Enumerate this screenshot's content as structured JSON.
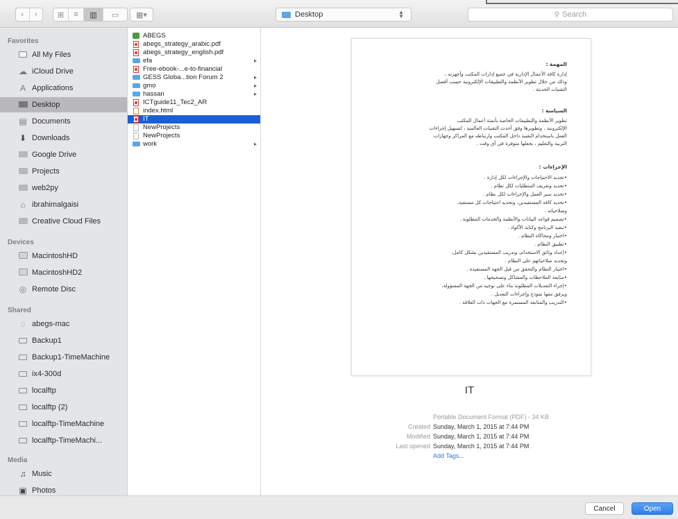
{
  "toolbar": {
    "path": "Desktop",
    "search_placeholder": "Search"
  },
  "sidebar": {
    "favorites_header": "Favorites",
    "favorites": [
      {
        "label": "All My Files",
        "icon": "all-files-icon"
      },
      {
        "label": "iCloud Drive",
        "icon": "cloud-icon"
      },
      {
        "label": "Applications",
        "icon": "applications-icon"
      },
      {
        "label": "Desktop",
        "icon": "desktop-folder-icon",
        "selected": true
      },
      {
        "label": "Documents",
        "icon": "documents-icon"
      },
      {
        "label": "Downloads",
        "icon": "downloads-icon"
      },
      {
        "label": "Google Drive",
        "icon": "folder-icon"
      },
      {
        "label": "Projects",
        "icon": "folder-icon"
      },
      {
        "label": "web2py",
        "icon": "folder-icon"
      },
      {
        "label": "ibrahimalgaisi",
        "icon": "home-icon"
      },
      {
        "label": "Creative Cloud Files",
        "icon": "folder-icon"
      }
    ],
    "devices_header": "Devices",
    "devices": [
      {
        "label": "MacintoshHD",
        "icon": "hard-disk-icon"
      },
      {
        "label": "MacintoshHD2",
        "icon": "hard-disk-icon"
      },
      {
        "label": "Remote Disc",
        "icon": "disc-icon"
      }
    ],
    "shared_header": "Shared",
    "shared": [
      {
        "label": "abegs-mac",
        "icon": "network-icon"
      },
      {
        "label": "Backup1",
        "icon": "monitor-icon"
      },
      {
        "label": "Backup1-TimeMachine",
        "icon": "monitor-icon"
      },
      {
        "label": "ix4-300d",
        "icon": "monitor-icon"
      },
      {
        "label": "localftp",
        "icon": "monitor-icon"
      },
      {
        "label": "localftp (2)",
        "icon": "monitor-icon"
      },
      {
        "label": "localftp-TimeMachine",
        "icon": "monitor-icon"
      },
      {
        "label": "localftp-TimeMachi...",
        "icon": "monitor-icon"
      }
    ],
    "media_header": "Media",
    "media": [
      {
        "label": "Music",
        "icon": "music-icon"
      },
      {
        "label": "Photos",
        "icon": "photos-icon"
      }
    ]
  },
  "files": [
    {
      "name": "ABEGS",
      "type": "app",
      "chevron": false
    },
    {
      "name": "abegs_strategy_arabic.pdf",
      "type": "pdf",
      "chevron": false
    },
    {
      "name": "abegs_strategy_english.pdf",
      "type": "pdf",
      "chevron": false
    },
    {
      "name": "efa",
      "type": "folder",
      "chevron": true
    },
    {
      "name": "Free-ebook-...e-to-financial",
      "type": "pdf",
      "chevron": false
    },
    {
      "name": "GESS Globa...tion Forum 2",
      "type": "folder",
      "chevron": true
    },
    {
      "name": "gmo",
      "type": "folder",
      "chevron": true
    },
    {
      "name": "hassan",
      "type": "folder",
      "chevron": true
    },
    {
      "name": "ICTguide11_Tec2_AR",
      "type": "pdf",
      "chevron": false
    },
    {
      "name": "index.html",
      "type": "html",
      "chevron": false
    },
    {
      "name": "IT",
      "type": "pdf",
      "chevron": false,
      "selected": true
    },
    {
      "name": "NewProjects",
      "type": "doc",
      "chevron": false
    },
    {
      "name": "NewProjects",
      "type": "doc",
      "chevron": false
    },
    {
      "name": "work",
      "type": "folder",
      "chevron": true
    }
  ],
  "preview": {
    "document_lines": [
      {
        "text": "المهمة :",
        "head": true
      },
      {
        "text": "إدارة كافة الأعمال الإدارية في جميع إدارات المكتب وأجهزته ،",
        "head": false
      },
      {
        "text": "وذلك من خلال تطوير الأنظمة والتطبيقات الإلكترونية حسب أفضل",
        "head": false
      },
      {
        "text": "التقنيات الحديثة .",
        "head": false
      },
      {
        "text": "السياسة :",
        "head": true
      },
      {
        "text": "تطوير الأنظمة والتطبيقات الخاصة بأتمتة أعمال المكتب",
        "head": false
      },
      {
        "text": "الإلكترونية ، وتطويرها وفق أحدث التقنيات العالمية ، لتسهيل إجراءات",
        "head": false
      },
      {
        "text": "العمل باستخدام التقنية داخل المكتب وارتباطه مع المراكز وجهازات",
        "head": false
      },
      {
        "text": "التربية والتعليم ، بجعلها متوفرة في أي وقت .",
        "head": false
      },
      {
        "text": "الإجراءات :",
        "head": true
      },
      {
        "text": "•تحديد الاحتياجات والإجراءات لكل إدارة .",
        "head": false
      },
      {
        "text": "•تحديد وتعريف المتطلبات لكل نظام .",
        "head": false
      },
      {
        "text": "•تحديد سير العمل والإجراءات لكل نظام .",
        "head": false
      },
      {
        "text": "•تحديد كافة المستفيدين، وتحديد احتياجات كل مستفيد،",
        "head": false
      },
      {
        "text": "وصلاحياته .",
        "head": false
      },
      {
        "text": "•تصميم قواعد البيانات والأنظمة والخدمات المطلوبة .",
        "head": false
      },
      {
        "text": "•تنفيذ البرنامج وكتابة الأكواد .",
        "head": false
      },
      {
        "text": "•اختبار ومحاكاة النظام .",
        "head": false
      },
      {
        "text": "•تطبيق النظام .",
        "head": false
      },
      {
        "text": "•إعداد وثائق الاستخدام، وتدريب المستفيدين بشكل كامل،",
        "head": false
      },
      {
        "text": "وتحديد صلاحياتهم على النظام .",
        "head": false
      },
      {
        "text": "•اختبار النظام والتحقق من قبل الجهة المستفيدة .",
        "head": false
      },
      {
        "text": "•متابعة الملاحظات والمشاكل وتصحيحها .",
        "head": false
      },
      {
        "text": "•إجراء التعديلات المطلوبة بناء على توجيه من الجهة المسؤولة،",
        "head": false
      },
      {
        "text": "ويرفق معها نموذج وإجراءات التعديل .",
        "head": false
      },
      {
        "text": "•التدريب والمتابعة المستمرة مع الجهات ذات العلاقة .",
        "head": false
      }
    ],
    "name": "IT",
    "kind": "Portable Document Format (PDF) - 34 KB",
    "created_label": "Created",
    "created": "Sunday, March 1, 2015 at 7:44 PM",
    "modified_label": "Modified",
    "modified": "Sunday, March 1, 2015 at 7:44 PM",
    "last_opened_label": "Last opened",
    "last_opened": "Sunday, March 1, 2015 at 7:44 PM",
    "add_tags": "Add Tags..."
  },
  "buttons": {
    "cancel": "Cancel",
    "open": "Open"
  },
  "colors": {
    "accent": "#2d7fe8",
    "selection": "#1a5fd6",
    "sidebar_selection": "#b9b9bc"
  }
}
